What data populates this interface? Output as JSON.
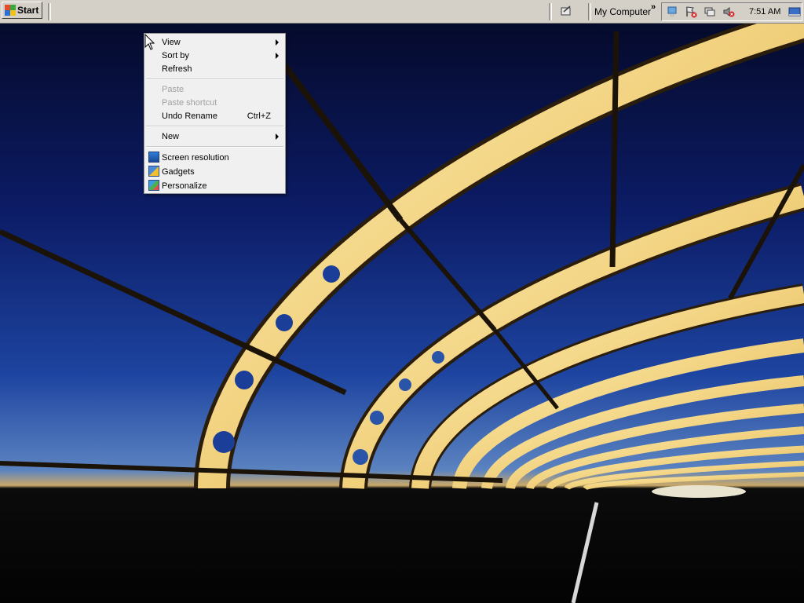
{
  "taskbar": {
    "start_label": "Start",
    "toolbar_label": "My Computer",
    "overflow_chevron": "»",
    "clock": "7:51 AM",
    "quick_launch_icon": "show-desktop-icon",
    "tray_icons": [
      "network-icon",
      "action-center-flag-icon",
      "network-disconnected-icon",
      "volume-muted-icon",
      "show-desktop-icon"
    ]
  },
  "context_menu": {
    "items": [
      {
        "label": "View",
        "submenu": true,
        "enabled": true
      },
      {
        "label": "Sort by",
        "submenu": true,
        "enabled": true
      },
      {
        "label": "Refresh",
        "enabled": true
      },
      {
        "label": "Paste",
        "enabled": false
      },
      {
        "label": "Paste shortcut",
        "enabled": false
      },
      {
        "label": "Undo Rename",
        "shortcut": "Ctrl+Z",
        "enabled": true
      },
      {
        "label": "New",
        "submenu": true,
        "enabled": true
      },
      {
        "label": "Screen resolution",
        "icon": "screen-resolution-icon",
        "enabled": true
      },
      {
        "label": "Gadgets",
        "icon": "gadgets-icon",
        "enabled": true
      },
      {
        "label": "Personalize",
        "icon": "personalize-icon",
        "enabled": true
      }
    ]
  },
  "colors": {
    "taskbar_bg": "#d4d0c8",
    "menu_bg": "#f0f0f0",
    "sky_top": "#050a2e",
    "sky_bottom": "#4a6fb5",
    "bridge": "#f3d68a"
  }
}
